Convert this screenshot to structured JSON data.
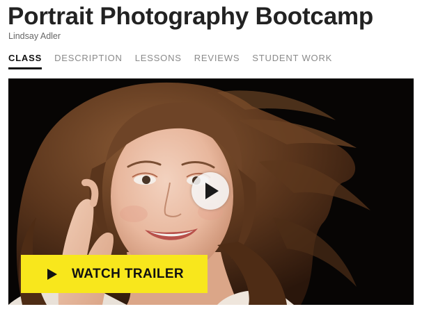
{
  "course": {
    "title": "Portrait Photography Bootcamp",
    "instructor": "Lindsay Adler"
  },
  "tabs": [
    {
      "label": "CLASS",
      "active": true
    },
    {
      "label": "DESCRIPTION",
      "active": false
    },
    {
      "label": "LESSONS",
      "active": false
    },
    {
      "label": "REVIEWS",
      "active": false
    },
    {
      "label": "STUDENT WORK",
      "active": false
    }
  ],
  "video": {
    "play_icon": "play-icon",
    "trailer_label": "WATCH TRAILER",
    "trailer_icon": "play-icon"
  },
  "colors": {
    "title": "#222222",
    "trailer_button": "#f8e71c",
    "video_background": "#080605"
  }
}
